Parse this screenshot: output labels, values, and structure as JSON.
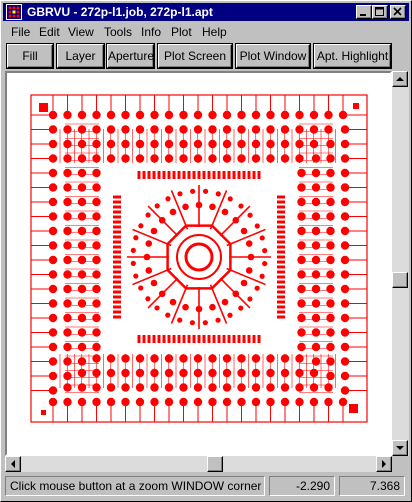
{
  "window": {
    "title": "GBRVU - 272p-l1.job, 272p-l1.apt",
    "icon": "gbrvu-app-icon",
    "controls": [
      "minimize-icon",
      "maximize-icon",
      "close-icon"
    ]
  },
  "menu": {
    "items": [
      {
        "label": "File"
      },
      {
        "label": "Edit"
      },
      {
        "label": "View"
      },
      {
        "label": "Tools"
      },
      {
        "label": "Info"
      },
      {
        "label": "Plot"
      },
      {
        "label": "Help"
      }
    ]
  },
  "toolbar": {
    "buttons": [
      {
        "label": "Fill"
      },
      {
        "label": "Layer"
      },
      {
        "label": "Aperture"
      },
      {
        "label": "Plot Screen"
      },
      {
        "label": "Plot Window"
      },
      {
        "label": "Apt. Highlight"
      }
    ]
  },
  "canvas": {
    "trace_color": "#ff0000",
    "background": "#ffffff"
  },
  "scrollbars": {
    "vertical_position": 0.55,
    "horizontal_position": 0.55
  },
  "status": {
    "message": "Click mouse button at a zoom WINDOW corner",
    "x_coord": "-2.290",
    "y_coord": "7.368"
  }
}
